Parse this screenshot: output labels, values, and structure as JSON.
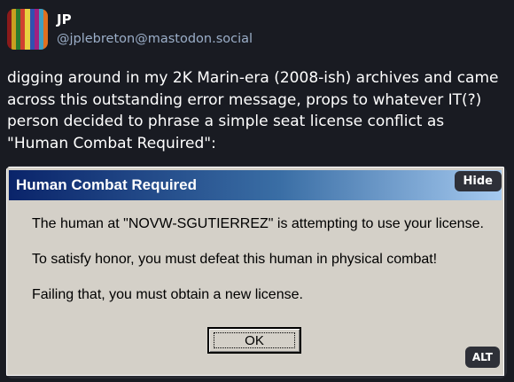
{
  "author": {
    "display_name": "JP",
    "handle": "@jplebreton@mastodon.social"
  },
  "post": {
    "text": "digging around in my 2K Marin-era (2008-ish) archives and came across this outstanding error message, props to whatever IT(?) person decided to phrase a simple seat license conflict as \"Human Combat Required\":"
  },
  "media": {
    "hide_label": "Hide",
    "alt_label": "ALT",
    "dialog": {
      "title": "Human Combat Required",
      "lines": [
        "The human at \"NOVW-SGUTIERREZ\" is attempting to use your license.",
        "To satisfy honor, you must defeat this human in physical combat!",
        "Failing that, you must obtain a new license."
      ],
      "ok_label": "OK"
    }
  },
  "colors": {
    "background": "#191b22",
    "handle": "#9baec8",
    "dialog_face": "#d4d0c8",
    "titlebar_start": "#0a246a",
    "titlebar_end": "#a6caf0"
  }
}
